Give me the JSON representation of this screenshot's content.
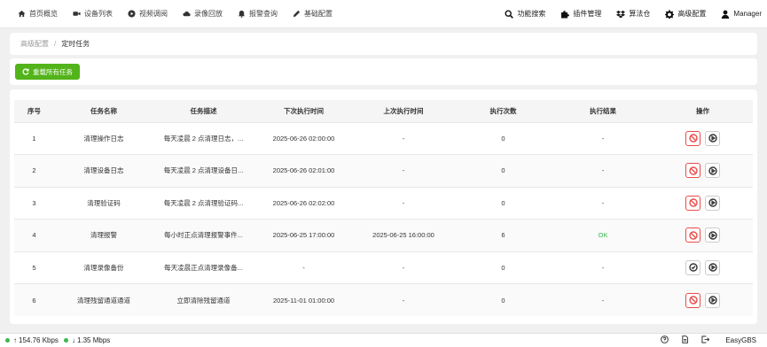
{
  "nav": {
    "left": [
      {
        "label": "首页概览",
        "icon": "home-icon"
      },
      {
        "label": "设备列表",
        "icon": "video-camera-icon"
      },
      {
        "label": "视频调阅",
        "icon": "play-circle-icon"
      },
      {
        "label": "录像回放",
        "icon": "cloud-icon"
      },
      {
        "label": "报警查询",
        "icon": "bell-icon"
      },
      {
        "label": "基础配置",
        "icon": "pencil-icon"
      }
    ],
    "right": [
      {
        "label": "功能搜索",
        "icon": "search-icon"
      },
      {
        "label": "插件管理",
        "icon": "puzzle-icon"
      },
      {
        "label": "算法仓",
        "icon": "dropbox-icon"
      },
      {
        "label": "高级配置",
        "icon": "gear-icon"
      },
      {
        "label": "Manager",
        "icon": "user-icon"
      }
    ]
  },
  "breadcrumb": {
    "parent": "高级配置",
    "current": "定时任务"
  },
  "toolbar": {
    "reload_label": "重载所有任务"
  },
  "table": {
    "headers": [
      "序号",
      "任务名称",
      "任务描述",
      "下次执行时间",
      "上次执行时间",
      "执行次数",
      "执行结果",
      "操作"
    ],
    "rows": [
      {
        "index": "1",
        "name": "清理操作日志",
        "desc": "每天凌晨 2 点清理日志，...",
        "next": "2025-06-26 02:00:00",
        "last": "-",
        "count": "0",
        "result": "-",
        "disabled": true
      },
      {
        "index": "2",
        "name": "清理设备日志",
        "desc": "每天凌晨 2 点清理设备日...",
        "next": "2025-06-26 02:01:00",
        "last": "-",
        "count": "0",
        "result": "-",
        "disabled": true
      },
      {
        "index": "3",
        "name": "清理验证码",
        "desc": "每天凌晨 2 点清理验证码...",
        "next": "2025-06-26 02:02:00",
        "last": "-",
        "count": "0",
        "result": "-",
        "disabled": true
      },
      {
        "index": "4",
        "name": "清理报警",
        "desc": "每小时正点清理报警事件...",
        "next": "2025-06-25 17:00:00",
        "last": "2025-06-25 16:00:00",
        "count": "6",
        "result": "OK",
        "disabled": true
      },
      {
        "index": "5",
        "name": "清理录像备份",
        "desc": "每天凌晨正点清理录像备...",
        "next": "-",
        "last": "-",
        "count": "0",
        "result": "-",
        "disabled": false
      },
      {
        "index": "6",
        "name": "清理残留通道通道",
        "desc": "立即清除残留通道",
        "next": "2025-11-01 01:00:00",
        "last": "-",
        "count": "0",
        "result": "-",
        "disabled": true
      }
    ]
  },
  "footer": {
    "upload": "154.76 Kbps",
    "download": "1.35 Mbps",
    "brand": "EasyGBS"
  },
  "colors": {
    "accent": "#52b41a",
    "danger": "#e84c4c",
    "ok": "#3cb84e"
  }
}
